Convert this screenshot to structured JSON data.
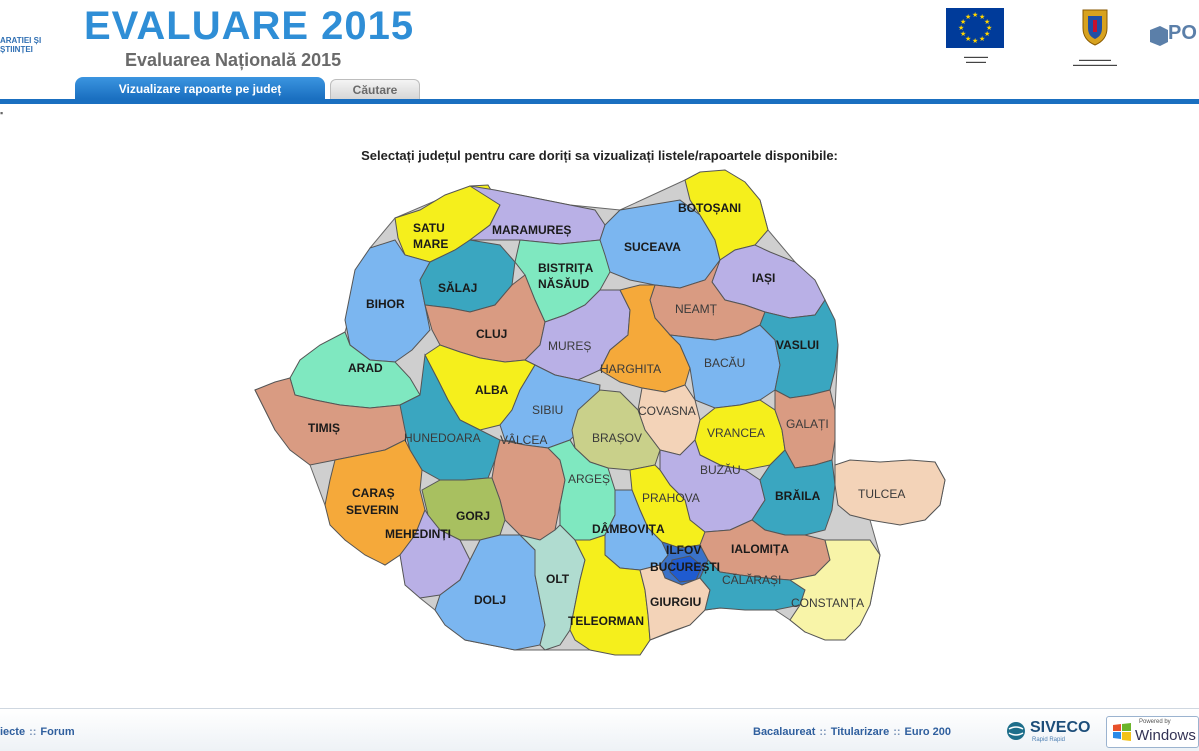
{
  "header": {
    "left_logo_line1": "ARATIEI ȘI",
    "left_logo_line2": "ȘTIINȚEI",
    "title": "EVALUARE 2015",
    "subtitle": "Evaluarea Națională 2015",
    "pos_logo_text": "PO"
  },
  "tabs": [
    {
      "label": "Vizualizare rapoarte pe județ",
      "active": true
    },
    {
      "label": "Căutare",
      "active": false
    }
  ],
  "instruction": "Selectați județul pentru care doriți sa vizualizați listele/rapoartele disponibile:",
  "counties": [
    {
      "id": "satu-mare",
      "label": "SATU MARE",
      "color": "#f5ef1c"
    },
    {
      "id": "maramures",
      "label": "MARAMUREȘ",
      "color": "#b9b0e6"
    },
    {
      "id": "suceava",
      "label": "SUCEAVA",
      "color": "#7bb6f0"
    },
    {
      "id": "botosani",
      "label": "BOTOȘANI",
      "color": "#f5ef1c"
    },
    {
      "id": "bihor",
      "label": "BIHOR",
      "color": "#7bb6f0"
    },
    {
      "id": "salaj",
      "label": "SĂLAJ",
      "color": "#3aa6c0"
    },
    {
      "id": "bistrita-nasaud",
      "label": "BISTRIȚA NĂSĂUD",
      "color": "#7fe8c0"
    },
    {
      "id": "iasi",
      "label": "IAȘI",
      "color": "#b9b0e6"
    },
    {
      "id": "neamt",
      "label": "NEAMȚ",
      "color": "#d99b82"
    },
    {
      "id": "cluj",
      "label": "CLUJ",
      "color": "#d99b82"
    },
    {
      "id": "mures",
      "label": "MUREȘ",
      "color": "#b9b0e6"
    },
    {
      "id": "harghita",
      "label": "HARGHITA",
      "color": "#f5a93a"
    },
    {
      "id": "bacau",
      "label": "BACĂU",
      "color": "#7bb6f0"
    },
    {
      "id": "vaslui",
      "label": "VASLUI",
      "color": "#3aa6c0"
    },
    {
      "id": "arad",
      "label": "ARAD",
      "color": "#7fe8c0"
    },
    {
      "id": "alba",
      "label": "ALBA",
      "color": "#f5ef1c"
    },
    {
      "id": "sibiu",
      "label": "SIBIU",
      "color": "#7bb6f0"
    },
    {
      "id": "covasna",
      "label": "COVASNA",
      "color": "#f3d3b8"
    },
    {
      "id": "timis",
      "label": "TIMIȘ",
      "color": "#d99b82"
    },
    {
      "id": "hunedoara",
      "label": "HUNEDOARA",
      "color": "#3aa6c0"
    },
    {
      "id": "brasov",
      "label": "BRAȘOV",
      "color": "#c9d08a"
    },
    {
      "id": "vrancea",
      "label": "VRANCEA",
      "color": "#f5ef1c"
    },
    {
      "id": "galati",
      "label": "GALAȚI",
      "color": "#d99b82"
    },
    {
      "id": "valcea",
      "label": "VÂLCEA",
      "color": "#d99b82"
    },
    {
      "id": "arges",
      "label": "ARGEȘ",
      "color": "#7fe8c0"
    },
    {
      "id": "buzau",
      "label": "BUZĂU",
      "color": "#b9b0e6"
    },
    {
      "id": "caras-severin",
      "label": "CARAȘ SEVERIN",
      "color": "#f5a93a"
    },
    {
      "id": "gorj",
      "label": "GORJ",
      "color": "#a8c060"
    },
    {
      "id": "prahova",
      "label": "PRAHOVA",
      "color": "#f5ef1c"
    },
    {
      "id": "braila",
      "label": "BRĂILA",
      "color": "#3aa6c0"
    },
    {
      "id": "tulcea",
      "label": "TULCEA",
      "color": "#f3d3b8"
    },
    {
      "id": "mehedinti",
      "label": "MEHEDINȚI",
      "color": "#b9b0e6"
    },
    {
      "id": "dambovita",
      "label": "DÂMBOVIȚA",
      "color": "#7bb6f0"
    },
    {
      "id": "ilfov",
      "label": "ILFOV",
      "color": "#3a72c8"
    },
    {
      "id": "bucuresti",
      "label": "BUCUREȘTI",
      "color": "#1f5bd0"
    },
    {
      "id": "ialomita",
      "label": "IALOMIȚA",
      "color": "#d99b82"
    },
    {
      "id": "dolj",
      "label": "DOLJ",
      "color": "#7bb6f0"
    },
    {
      "id": "olt",
      "label": "OLT",
      "color": "#b0dcd0"
    },
    {
      "id": "teleorman",
      "label": "TELEORMAN",
      "color": "#f5ef1c"
    },
    {
      "id": "giurgiu",
      "label": "GIURGIU",
      "color": "#f3d3b8"
    },
    {
      "id": "calarasi",
      "label": "CĂLĂRAȘI",
      "color": "#3aa6c0"
    },
    {
      "id": "constanta",
      "label": "CONSTANȚA",
      "color": "#f8f4a8"
    }
  ],
  "footer": {
    "left_links": [
      "iecte",
      "Forum"
    ],
    "right_links": [
      "Bacalaureat",
      "Titularizare",
      "Euro 200"
    ],
    "separator": "::",
    "siveco": "SIVECO",
    "siveco_sub": "Rapid Rapid",
    "win_powered": "Powered by",
    "win_text": "Windows"
  },
  "colors": {
    "title_blue": "#2f8ed6",
    "tab_blue": "#1a6fc0",
    "link_blue": "#2f5f9e"
  }
}
